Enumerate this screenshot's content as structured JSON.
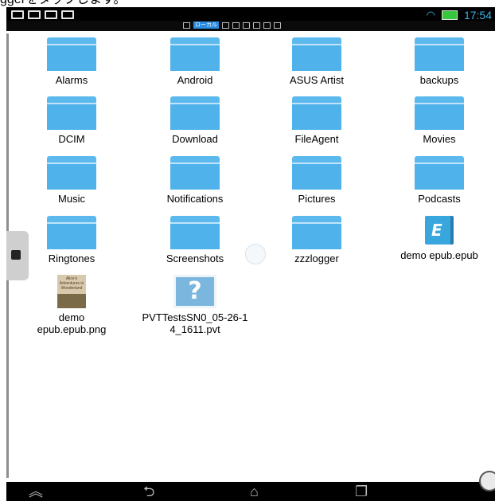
{
  "caption": "ggerをタップします。",
  "status": {
    "time": "17:54"
  },
  "notif": {
    "tag": "ローカル"
  },
  "files": [
    {
      "name": "Alarms",
      "type": "folder"
    },
    {
      "name": "Android",
      "type": "folder"
    },
    {
      "name": "ASUS Artist",
      "type": "folder"
    },
    {
      "name": "backups",
      "type": "folder"
    },
    {
      "name": "DCIM",
      "type": "folder"
    },
    {
      "name": "Download",
      "type": "folder"
    },
    {
      "name": "FileAgent",
      "type": "folder"
    },
    {
      "name": "Movies",
      "type": "folder"
    },
    {
      "name": "Music",
      "type": "folder"
    },
    {
      "name": "Notifications",
      "type": "folder"
    },
    {
      "name": "Pictures",
      "type": "folder"
    },
    {
      "name": "Podcasts",
      "type": "folder"
    },
    {
      "name": "Ringtones",
      "type": "folder"
    },
    {
      "name": "Screenshots",
      "type": "folder"
    },
    {
      "name": "zzzlogger",
      "type": "folder"
    },
    {
      "name": "demo epub.epub",
      "type": "epub"
    },
    {
      "name": "demo epub.epub.png",
      "type": "image",
      "cover_text": "Alice's Adventures in Wonderland"
    },
    {
      "name": "PVTTestsSN0_05-26-14_1611.pvt",
      "type": "unknown",
      "glyph": "?"
    }
  ],
  "nav": {
    "back": "⮌",
    "home": "⌂",
    "recent": "❐",
    "up": "︽"
  }
}
